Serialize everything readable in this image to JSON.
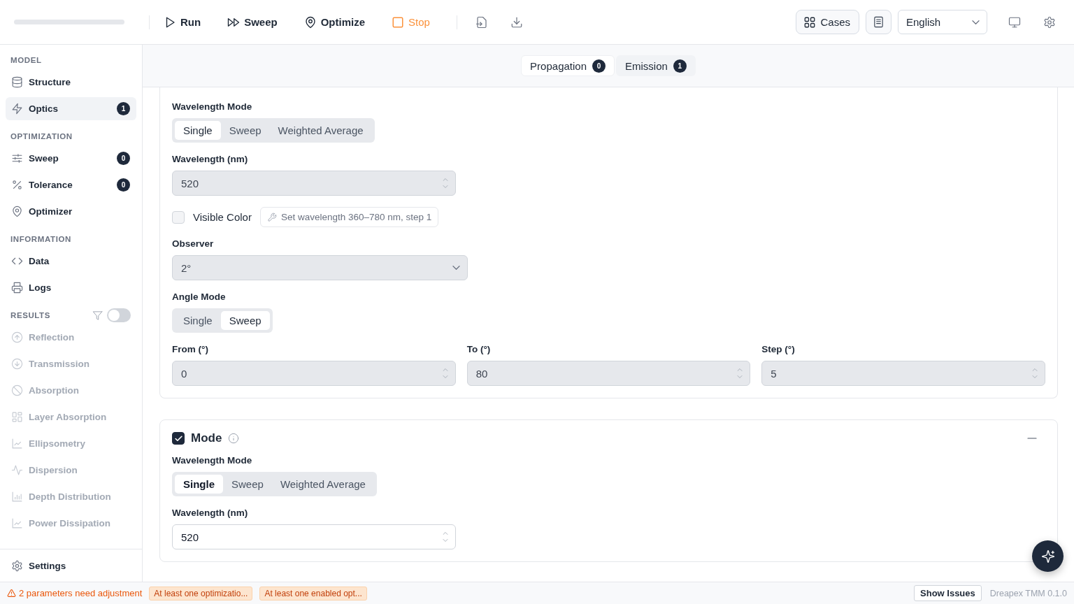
{
  "toolbar": {
    "actions": [
      {
        "kind": "run",
        "label": "Run"
      },
      {
        "kind": "sweep",
        "label": "Sweep"
      },
      {
        "kind": "optimize",
        "label": "Optimize"
      },
      {
        "kind": "stop",
        "label": "Stop"
      }
    ],
    "cases": "Cases",
    "language": "English"
  },
  "sidebar": {
    "sections": [
      {
        "title": "MODEL",
        "items": [
          {
            "label": "Structure",
            "selected": false,
            "disabled": false
          },
          {
            "label": "Optics",
            "selected": true,
            "disabled": false,
            "badge": "1"
          }
        ]
      },
      {
        "title": "OPTIMIZATION",
        "items": [
          {
            "label": "Sweep",
            "selected": false,
            "disabled": false,
            "badge": "0"
          },
          {
            "label": "Tolerance",
            "selected": false,
            "disabled": false,
            "badge": "0"
          },
          {
            "label": "Optimizer",
            "selected": false,
            "disabled": false
          }
        ]
      },
      {
        "title": "INFORMATION",
        "items": [
          {
            "label": "Data",
            "selected": false,
            "disabled": false
          },
          {
            "label": "Logs",
            "selected": false,
            "disabled": false
          }
        ]
      },
      {
        "title": "RESULTS",
        "filter_on": false,
        "items": [
          {
            "label": "Reflection",
            "selected": false,
            "disabled": true
          },
          {
            "label": "Transmission",
            "selected": false,
            "disabled": true
          },
          {
            "label": "Absorption",
            "selected": false,
            "disabled": true
          },
          {
            "label": "Layer Absorption",
            "selected": false,
            "disabled": true
          },
          {
            "label": "Ellipsometry",
            "selected": false,
            "disabled": true
          },
          {
            "label": "Dispersion",
            "selected": false,
            "disabled": true
          },
          {
            "label": "Depth Distribution",
            "selected": false,
            "disabled": true
          },
          {
            "label": "Power Dissipation",
            "selected": false,
            "disabled": true
          }
        ]
      }
    ],
    "settings": "Settings"
  },
  "tabs": [
    {
      "label": "Propagation",
      "count": "0",
      "selected": true
    },
    {
      "label": "Emission",
      "count": "1",
      "selected": false
    }
  ],
  "sections": [
    {
      "rows": [
        {
          "kind": "segmented",
          "label": "Wavelength Mode",
          "options": [
            {
              "label": "Single",
              "selected": true
            },
            {
              "label": "Sweep",
              "selected": false
            },
            {
              "label": "Weighted Average",
              "selected": false
            }
          ]
        },
        {
          "kind": "number",
          "label": "Wavelength (nm)",
          "value": "520",
          "disabled": true
        },
        {
          "kind": "checkbox",
          "label": "Visible Color",
          "checked": false,
          "hint": "Set wavelength 360–780 nm, step 1"
        },
        {
          "kind": "select",
          "label": "Observer",
          "value": "2°",
          "disabled": true
        },
        {
          "kind": "segmented",
          "label": "Angle Mode",
          "options": [
            {
              "label": "Single",
              "selected": false
            },
            {
              "label": "Sweep",
              "selected": true
            }
          ]
        },
        {
          "kind": "fields",
          "fields": [
            {
              "label": "From (°)",
              "value": "0",
              "disabled": true
            },
            {
              "label": "To (°)",
              "value": "80",
              "disabled": true
            },
            {
              "label": "Step (°)",
              "value": "5",
              "disabled": true
            }
          ]
        }
      ]
    },
    {
      "title": "Mode",
      "enabled": true,
      "rows": [
        {
          "kind": "segmented",
          "label": "Wavelength Mode",
          "options": [
            {
              "label": "Single",
              "selected": true
            },
            {
              "label": "Sweep",
              "selected": false
            },
            {
              "label": "Weighted Average",
              "selected": false
            }
          ]
        },
        {
          "kind": "number",
          "label": "Wavelength (nm)",
          "value": "520",
          "disabled": false
        }
      ]
    }
  ],
  "status": {
    "warning": "2 parameters need adjustment",
    "chips": [
      "At least one optimizatio...",
      "At least one enabled opt..."
    ],
    "show_issues": "Show Issues",
    "version": "Dreapex TMM 0.1.0"
  }
}
